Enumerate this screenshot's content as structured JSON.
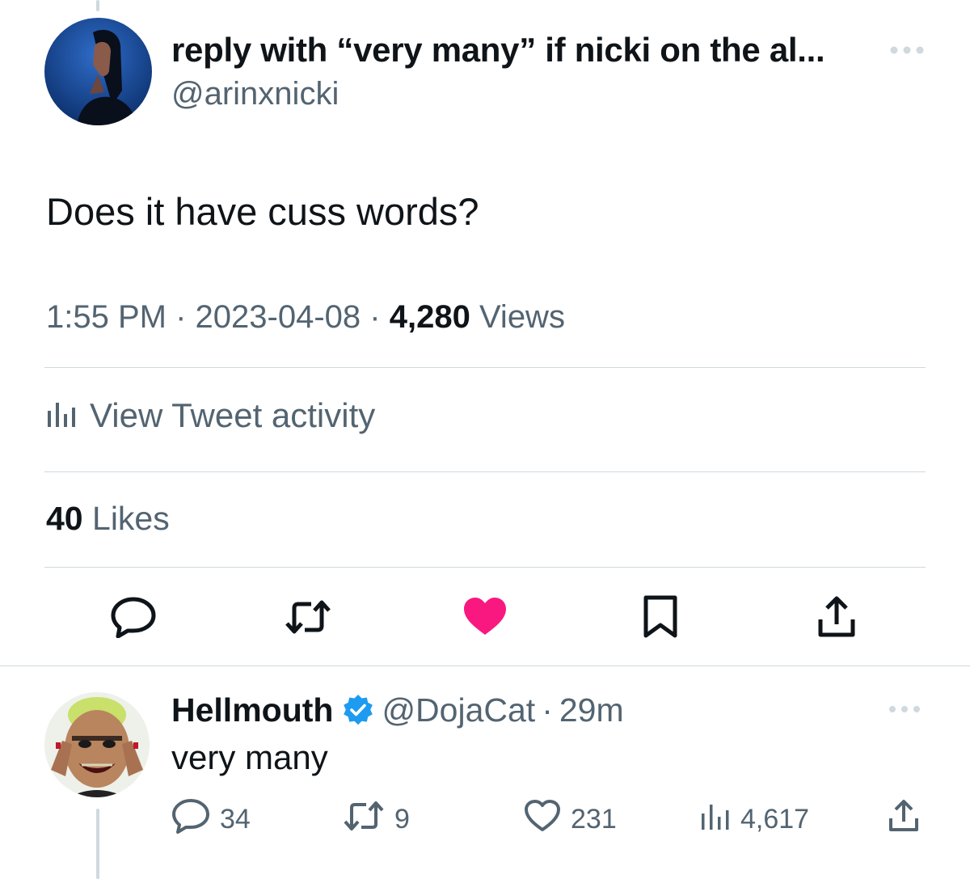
{
  "main_tweet": {
    "display_name": "reply with “very many” if nicki on the al...",
    "handle": "@arinxnicki",
    "text": "Does it have cuss words?",
    "time": "1:55 PM",
    "date": "2023-04-08",
    "views_count": "4,280",
    "views_label": "Views",
    "separator": "·",
    "activity_label": "View Tweet activity",
    "likes_count": "40",
    "likes_label": "Likes"
  },
  "actions": {
    "icons": [
      "reply-icon",
      "retweet-icon",
      "like-filled-icon",
      "bookmark-icon",
      "share-icon"
    ],
    "like_color": "#f91880"
  },
  "reply": {
    "display_name": "Hellmouth",
    "verified": true,
    "handle": "@DojaCat",
    "separator": "·",
    "time": "29m",
    "text": "very many",
    "reply_count": "34",
    "retweet_count": "9",
    "like_count": "231",
    "view_count": "4,617"
  },
  "colors": {
    "text_primary": "#0f1419",
    "text_secondary": "#536471",
    "divider": "#cfd9de",
    "verified_blue": "#1d9bf0",
    "like_pink": "#f91880"
  }
}
